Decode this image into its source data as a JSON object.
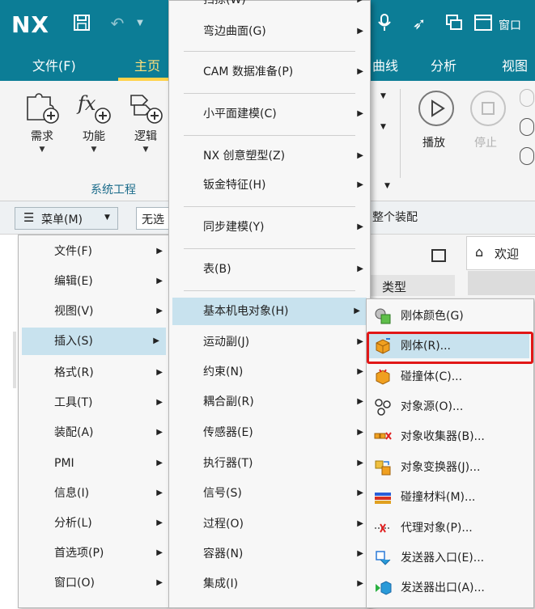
{
  "titlebar": {
    "logo": "NX",
    "window_menu": "窗口"
  },
  "tabs": {
    "file": "文件(F)",
    "home": "主页",
    "curve": "曲线",
    "analysis": "分析",
    "view": "视图"
  },
  "ribbon": {
    "require": "需求",
    "function": "功能",
    "logic": "逻辑",
    "group_label": "系统工程",
    "play": "播放",
    "stop": "停止"
  },
  "commandbar": {
    "menu": "菜单(M)",
    "filter": "无选",
    "assembly": "整个装配"
  },
  "background": {
    "welcome_tab": "欢迎",
    "type_col": "类型"
  },
  "menu1": [
    "文件(F)",
    "编辑(E)",
    "视图(V)",
    "插入(S)",
    "格式(R)",
    "工具(T)",
    "装配(A)",
    "PMI",
    "信息(I)",
    "分析(L)",
    "首选项(P)",
    "窗口(O)"
  ],
  "menu2": [
    "扫掠(W)",
    "弯边曲面(G)",
    "CAM 数据准备(P)",
    "小平面建模(C)",
    "NX 创意塑型(Z)",
    "钣金特征(H)",
    "同步建模(Y)",
    "表(B)",
    "基本机电对象(H)",
    "运动副(J)",
    "约束(N)",
    "耦合副(R)",
    "传感器(E)",
    "执行器(T)",
    "信号(S)",
    "过程(O)",
    "容器(N)",
    "集成(I)"
  ],
  "menu3": [
    "刚体颜色(G)",
    "刚体(R)...",
    "碰撞体(C)...",
    "对象源(O)...",
    "对象收集器(B)...",
    "对象变换器(J)...",
    "碰撞材料(M)...",
    "代理对象(P)...",
    "发送器入口(E)...",
    "发送器出口(A)..."
  ]
}
